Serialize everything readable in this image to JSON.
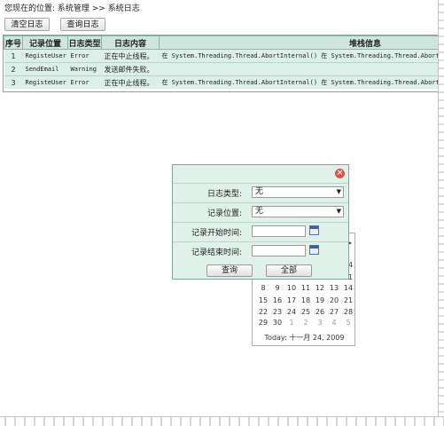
{
  "breadcrumb": "您现在的位置: 系统管理 >> 系统日志",
  "toolbar": {
    "clear_label": "清空日志",
    "query_label": "查询日志"
  },
  "grid": {
    "headers": [
      "序号",
      "记录位置",
      "日志类型",
      "日志内容",
      "堆栈信息"
    ],
    "rows": [
      [
        "1",
        "RegisteUser",
        "Error",
        "正在中止线程。",
        "在 System.Threading.Thread.AbortInternal() 在 System.Threading.Thread.Abort(O"
      ],
      [
        "2",
        "SendEmail",
        "Warning",
        "发送邮件失败。",
        ""
      ],
      [
        "3",
        "RegisteUser",
        "Error",
        "正在中止线程。",
        "在 System.Threading.Thread.AbortInternal() 在 System.Threading.Thread.Abort(O"
      ]
    ]
  },
  "dialog": {
    "log_type_label": "日志类型:",
    "log_type_value": "无",
    "location_label": "记录位置:",
    "location_value": "无",
    "start_label": "记录开始时间:",
    "end_label": "记录结束时间:",
    "query_button": "查询",
    "all_button": "全部"
  },
  "calendar": {
    "rows": [
      [
        "",
        "",
        "",
        "",
        "",
        "",
        "14"
      ],
      [
        "",
        "",
        "",
        "",
        "",
        "",
        "21"
      ],
      [
        "8",
        "9",
        "10",
        "11",
        "12",
        "13",
        "14"
      ],
      [
        "15",
        "16",
        "17",
        "18",
        "19",
        "20",
        "21"
      ],
      [
        "22",
        "23",
        "24",
        "25",
        "26",
        "27",
        "28"
      ],
      [
        "29",
        "30",
        "1",
        "2",
        "3",
        "4",
        "5"
      ]
    ],
    "today_label": "Today: 十一月 24, 2009"
  },
  "colors": {
    "grid_header": "#cfe6dc",
    "grid_row": "#dcefe8",
    "dialog_bg": "#dff1e9"
  }
}
